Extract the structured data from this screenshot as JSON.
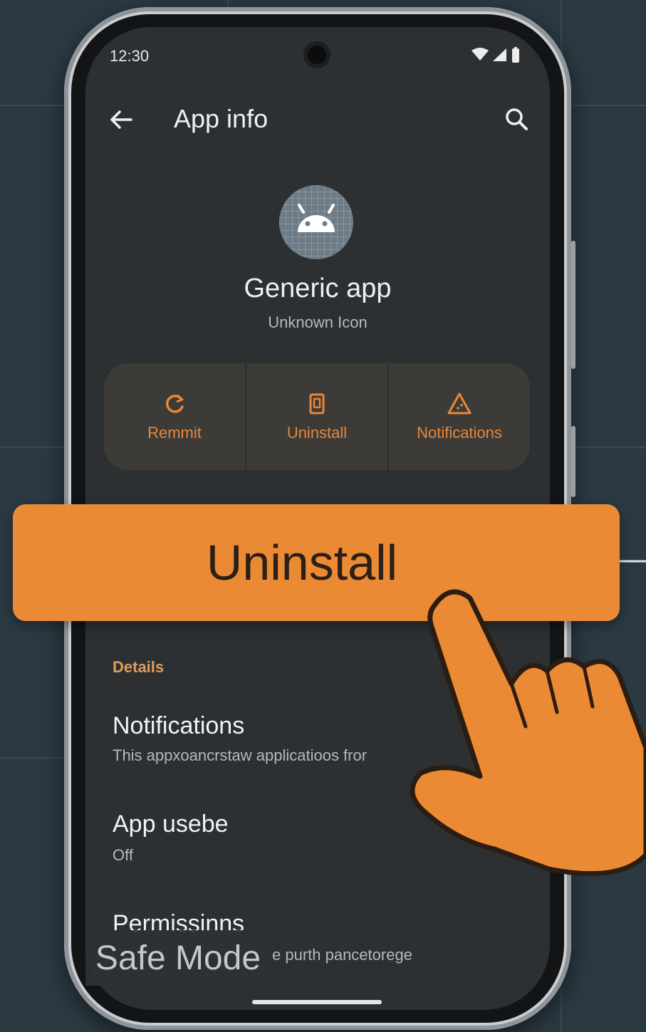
{
  "status_bar": {
    "time": "12:30"
  },
  "header": {
    "title": "App info"
  },
  "app": {
    "name": "Generic app",
    "subtitle": "Unknown Icon"
  },
  "actions": [
    {
      "label": "Remmit",
      "icon": "refresh-icon"
    },
    {
      "label": "Uninstall",
      "icon": "trash-icon"
    },
    {
      "label": "Notifications",
      "icon": "warning-icon"
    }
  ],
  "details": {
    "header": "Details",
    "items": [
      {
        "title": "Notifications",
        "subtitle": "This appxoancrstaw applicatioos fror"
      },
      {
        "title": "App usebe",
        "subtitle": "Off"
      },
      {
        "title": "Permissinns",
        "subtitle": "e purth pancetorege"
      }
    ]
  },
  "overlay": {
    "label": "Uninstall"
  },
  "watermark": {
    "label": "Safe Mode"
  },
  "colors": {
    "accent": "#ea8a34",
    "screen_bg": "#2c3033",
    "page_bg": "#2b3942"
  }
}
